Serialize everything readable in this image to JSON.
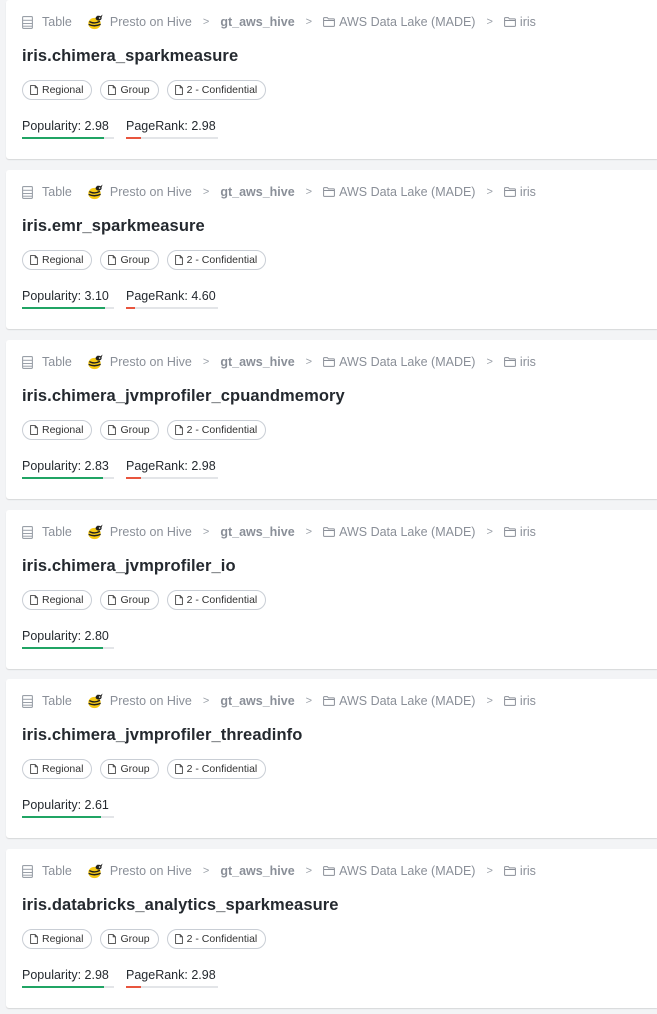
{
  "colors": {
    "popularity_bar": "#20a464",
    "pagerank_bar": "#e8553e",
    "track": "#e3e5e8",
    "card_bg": "#ffffff",
    "page_bg": "#f3f4f6"
  },
  "results": [
    {
      "type_label": "Table",
      "breadcrumbs": [
        "Presto on Hive",
        "gt_aws_hive",
        "AWS Data Lake (MADE)",
        "iris"
      ],
      "title": "iris.chimera_sparkmeasure",
      "tags": [
        "Regional",
        "Group",
        "2 - Confidential"
      ],
      "popularity_label": "Popularity:",
      "popularity": "2.98",
      "popularity_level": 0.89,
      "pagerank_label": "PageRank:",
      "pagerank": "2.98",
      "pagerank_level": 0.16
    },
    {
      "type_label": "Table",
      "breadcrumbs": [
        "Presto on Hive",
        "gt_aws_hive",
        "AWS Data Lake (MADE)",
        "iris"
      ],
      "title": "iris.emr_sparkmeasure",
      "tags": [
        "Regional",
        "Group",
        "2 - Confidential"
      ],
      "popularity_label": "Popularity:",
      "popularity": "3.10",
      "popularity_level": 0.9,
      "pagerank_label": "PageRank:",
      "pagerank": "4.60",
      "pagerank_level": 0.1
    },
    {
      "type_label": "Table",
      "breadcrumbs": [
        "Presto on Hive",
        "gt_aws_hive",
        "AWS Data Lake (MADE)",
        "iris"
      ],
      "title": "iris.chimera_jvmprofiler_cpuandmemory",
      "tags": [
        "Regional",
        "Group",
        "2 - Confidential"
      ],
      "popularity_label": "Popularity:",
      "popularity": "2.83",
      "popularity_level": 0.88,
      "pagerank_label": "PageRank:",
      "pagerank": "2.98",
      "pagerank_level": 0.16
    },
    {
      "type_label": "Table",
      "breadcrumbs": [
        "Presto on Hive",
        "gt_aws_hive",
        "AWS Data Lake (MADE)",
        "iris"
      ],
      "title": "iris.chimera_jvmprofiler_io",
      "tags": [
        "Regional",
        "Group",
        "2 - Confidential"
      ],
      "popularity_label": "Popularity:",
      "popularity": "2.80",
      "popularity_level": 0.88
    },
    {
      "type_label": "Table",
      "breadcrumbs": [
        "Presto on Hive",
        "gt_aws_hive",
        "AWS Data Lake (MADE)",
        "iris"
      ],
      "title": "iris.chimera_jvmprofiler_threadinfo",
      "tags": [
        "Regional",
        "Group",
        "2 - Confidential"
      ],
      "popularity_label": "Popularity:",
      "popularity": "2.61",
      "popularity_level": 0.86
    },
    {
      "type_label": "Table",
      "breadcrumbs": [
        "Presto on Hive",
        "gt_aws_hive",
        "AWS Data Lake (MADE)",
        "iris"
      ],
      "title": "iris.databricks_analytics_sparkmeasure",
      "tags": [
        "Regional",
        "Group",
        "2 - Confidential"
      ],
      "popularity_label": "Popularity:",
      "popularity": "2.98",
      "popularity_level": 0.89,
      "pagerank_label": "PageRank:",
      "pagerank": "2.98",
      "pagerank_level": 0.16
    }
  ]
}
